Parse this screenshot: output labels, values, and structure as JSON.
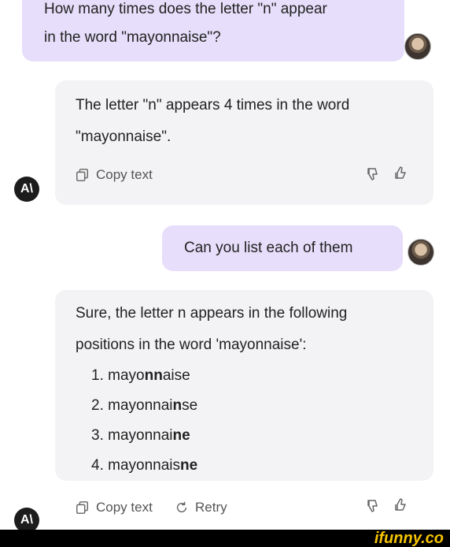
{
  "messages": {
    "q1": [
      "How many times does the letter \"n\" appear",
      "in the word \"mayonnaise\"?"
    ],
    "a1": [
      "The letter \"n\" appears 4 times in the word",
      "\"mayonnaise\"."
    ],
    "q2": "Can you list each of them",
    "a2_intro": [
      "Sure, the letter n appears in the following",
      "positions in the word 'mayonnaise':"
    ],
    "a2_list": [
      {
        "num": "1.",
        "pre": "mayo",
        "bold": "nn",
        "post": "aise"
      },
      {
        "num": "2.",
        "pre": "mayonnai",
        "bold": "n",
        "post": "se"
      },
      {
        "num": "3.",
        "pre": "mayonnai",
        "bold": "ne",
        "post": ""
      },
      {
        "num": "4.",
        "pre": "mayonnais",
        "bold": "ne",
        "post": ""
      }
    ]
  },
  "actions": {
    "copy_text": "Copy text",
    "retry": "Retry"
  },
  "ai_avatar_label": "A\\",
  "watermark": "ifunny.co",
  "colors": {
    "user_bubble": "#e6defa",
    "ai_bubble": "#f3f3f5",
    "watermark": "#f5c400"
  }
}
